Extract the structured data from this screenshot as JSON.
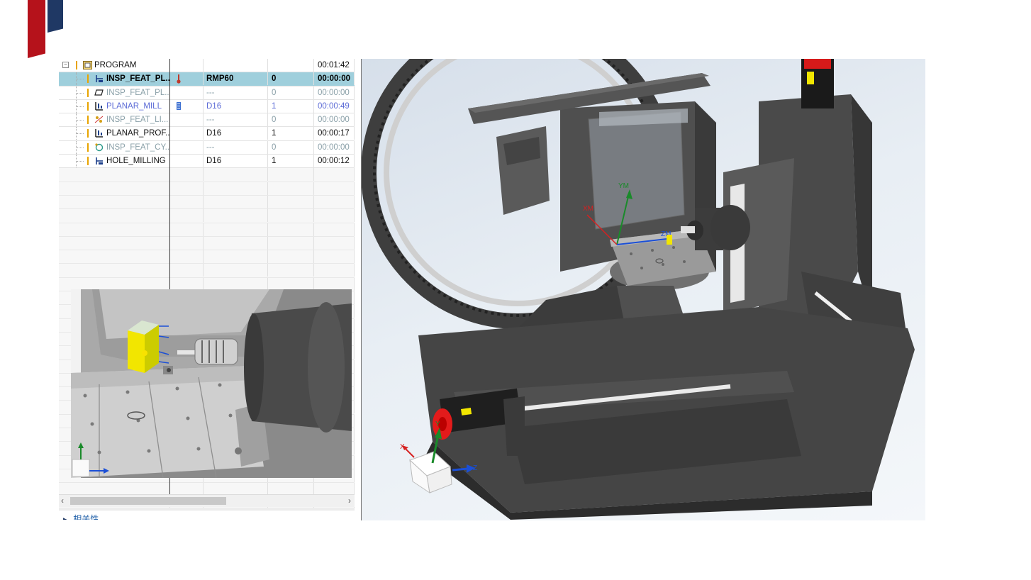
{
  "operations": [
    {
      "name": "PROGRAM",
      "path": "",
      "tool": "",
      "num": "",
      "time": "00:01:42",
      "style": "dark",
      "icon": "program",
      "level": 0,
      "selected": false
    },
    {
      "name": "INSP_FEAT_PL...",
      "path": "thermo",
      "tool": "RMP60",
      "num": "0",
      "time": "00:00:00",
      "style": "dark",
      "icon": "probe",
      "level": 1,
      "selected": true
    },
    {
      "name": "INSP_FEAT_PL...",
      "path": "",
      "tool": "---",
      "num": "0",
      "time": "00:00:00",
      "style": "gray",
      "icon": "plane",
      "level": 1,
      "selected": false
    },
    {
      "name": "PLANAR_MILL",
      "path": "gauge",
      "tool": "D16",
      "num": "1",
      "time": "00:00:49",
      "style": "blue",
      "icon": "mill",
      "level": 1,
      "selected": false
    },
    {
      "name": "INSP_FEAT_LI...",
      "path": "",
      "tool": "---",
      "num": "0",
      "time": "00:00:00",
      "style": "gray",
      "icon": "line",
      "level": 1,
      "selected": false
    },
    {
      "name": "PLANAR_PROF...",
      "path": "",
      "tool": "D16",
      "num": "1",
      "time": "00:00:17",
      "style": "dark",
      "icon": "mill",
      "level": 1,
      "selected": false
    },
    {
      "name": "INSP_FEAT_CY...",
      "path": "",
      "tool": "---",
      "num": "0",
      "time": "00:00:00",
      "style": "gray",
      "icon": "cyl",
      "level": 1,
      "selected": false
    },
    {
      "name": "HOLE_MILLING",
      "path": "",
      "tool": "D16",
      "num": "1",
      "time": "00:00:12",
      "style": "dark",
      "icon": "probe",
      "level": 1,
      "selected": false
    }
  ],
  "dependencies_label": "相关性",
  "viewport": {
    "axes_main": {
      "x": "X",
      "y": "Y",
      "z": "Z"
    },
    "axes_machine": {
      "xm": "XM",
      "ym": "YM",
      "zm": "ZM"
    }
  },
  "colors": {
    "brand_red": "#b5121b",
    "brand_blue": "#1f3864",
    "selection": "#9fcfdc",
    "motor_red": "#e31b1b",
    "accent_yellow": "#f2e600"
  }
}
